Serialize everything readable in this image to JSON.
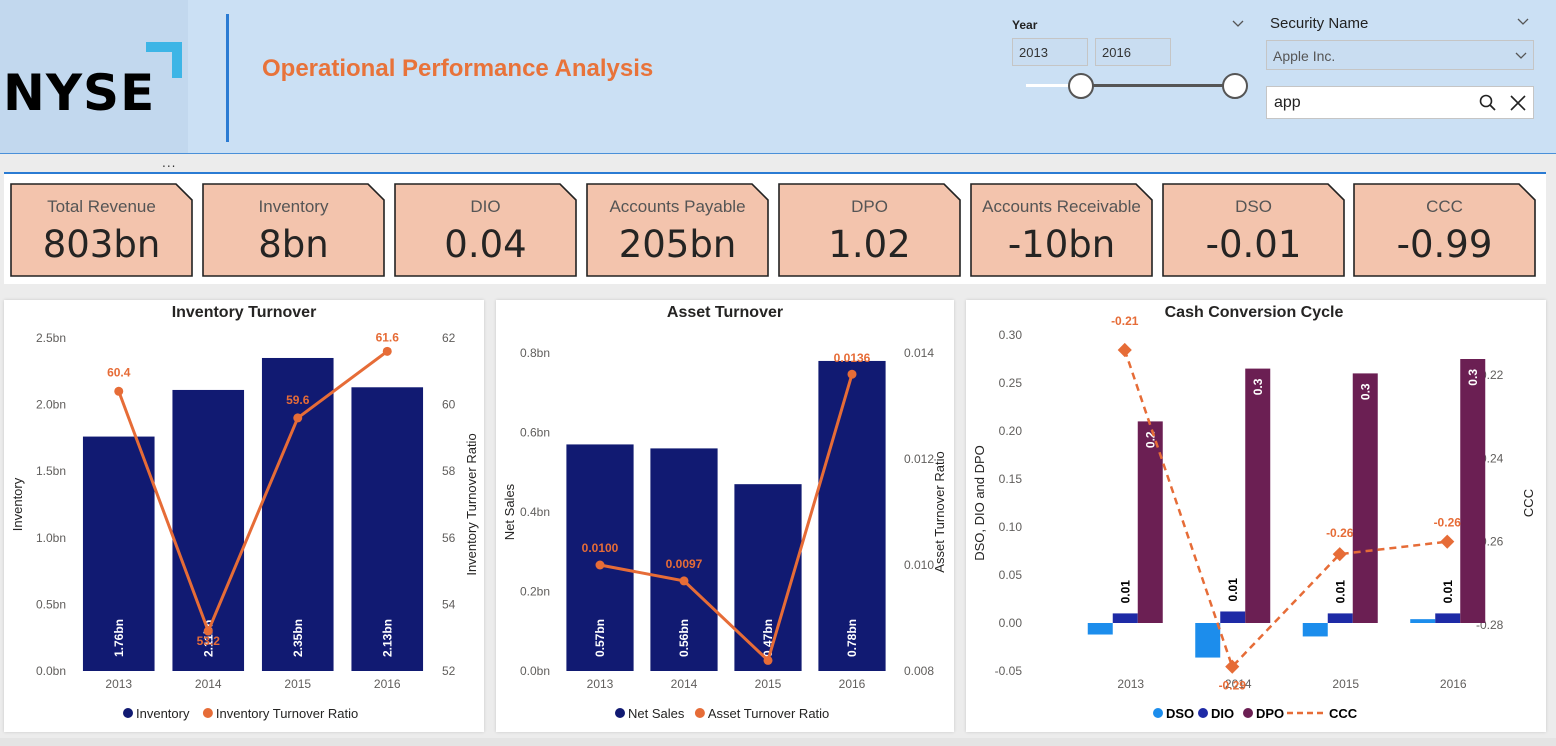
{
  "header": {
    "logo_text": "NYSE",
    "title": "Operational Performance Analysis",
    "more_dots": "..."
  },
  "year_slicer": {
    "label": "Year",
    "start": "2013",
    "end": "2016",
    "range_fraction": [
      0.25,
      1.0
    ]
  },
  "security_slicer": {
    "label": "Security Name",
    "selected": "Apple Inc.",
    "search_value": "app",
    "icons": [
      "search-icon",
      "clear-icon"
    ]
  },
  "kpis": [
    {
      "label": "Total Revenue",
      "value": "803bn"
    },
    {
      "label": "Inventory",
      "value": "8bn"
    },
    {
      "label": "DIO",
      "value": "0.04"
    },
    {
      "label": "Accounts Payable",
      "value": "205bn"
    },
    {
      "label": "DPO",
      "value": "1.02"
    },
    {
      "label": "Accounts Receivable",
      "value": "-10bn"
    },
    {
      "label": "DSO",
      "value": "-0.01"
    },
    {
      "label": "CCC",
      "value": "-0.99"
    }
  ],
  "colors": {
    "bar_navy": "#111a72",
    "line_orange": "#e66c37",
    "dso_blue": "#1c8dec",
    "dio_blue": "#1e2aa6",
    "dpo_purple": "#6b1f53",
    "kpi_fill": "#f3c4ad",
    "title_orange": "#e8733a"
  },
  "chart_data": [
    {
      "type": "bar",
      "title": "Inventory Turnover",
      "categories": [
        "2013",
        "2014",
        "2015",
        "2016"
      ],
      "ylabel": "Inventory",
      "y2label": "Inventory Turnover Ratio",
      "ylim": [
        0,
        2.5
      ],
      "yticks": [
        "0.0bn",
        "0.5bn",
        "1.0bn",
        "1.5bn",
        "2.0bn",
        "2.5bn"
      ],
      "y2lim": [
        52,
        62
      ],
      "y2ticks": [
        "52",
        "54",
        "56",
        "58",
        "60",
        "62"
      ],
      "series": [
        {
          "name": "Inventory",
          "kind": "bar",
          "values": [
            1.76,
            2.11,
            2.35,
            2.13
          ],
          "labels": [
            "1.76bn",
            "2.11bn",
            "2.35bn",
            "2.13bn"
          ]
        },
        {
          "name": "Inventory Turnover Ratio",
          "kind": "line",
          "values": [
            60.4,
            53.2,
            59.6,
            61.6
          ],
          "labels": [
            "60.4",
            "53.2",
            "59.6",
            "61.6"
          ]
        }
      ],
      "legend_position": "bottom"
    },
    {
      "type": "bar",
      "title": "Asset Turnover",
      "categories": [
        "2013",
        "2014",
        "2015",
        "2016"
      ],
      "ylabel": "Net Sales",
      "y2label": "Asset Turnover Ratio",
      "ylim": [
        0,
        0.8
      ],
      "yticks": [
        "0.0bn",
        "0.2bn",
        "0.4bn",
        "0.6bn",
        "0.8bn"
      ],
      "y2lim": [
        0.008,
        0.014
      ],
      "y2ticks": [
        "0.008",
        "0.010",
        "0.012",
        "0.014"
      ],
      "series": [
        {
          "name": "Net Sales",
          "kind": "bar",
          "values": [
            0.57,
            0.56,
            0.47,
            0.78
          ],
          "labels": [
            "0.57bn",
            "0.56bn",
            "0.47bn",
            "0.78bn"
          ]
        },
        {
          "name": "Asset Turnover Ratio",
          "kind": "line",
          "values": [
            0.01,
            0.0097,
            0.0082,
            0.0136
          ],
          "labels": [
            "0.0100",
            "0.0097",
            "",
            "0.0136"
          ]
        }
      ],
      "legend_position": "bottom"
    },
    {
      "type": "bar",
      "title": "Cash Conversion Cycle",
      "categories": [
        "2013",
        "2014",
        "2015",
        "2016"
      ],
      "ylabel": "DSO, DIO and DPO",
      "y2label": "CCC",
      "ylim": [
        -0.05,
        0.3
      ],
      "yticks": [
        "-0.05",
        "0.00",
        "0.05",
        "0.10",
        "0.15",
        "0.20",
        "0.25",
        "0.30"
      ],
      "y2lim": [
        -0.28,
        -0.22
      ],
      "y2ticks": [
        "-0.28",
        "-0.26",
        "-0.24",
        "-0.22"
      ],
      "series": [
        {
          "name": "DSO",
          "kind": "bar",
          "values": [
            -0.012,
            -0.036,
            -0.014,
            0.004
          ]
        },
        {
          "name": "DIO",
          "kind": "bar",
          "values": [
            0.01,
            0.012,
            0.01,
            0.01
          ],
          "labels": [
            "0.01",
            "0.01",
            "0.01",
            "0.01"
          ]
        },
        {
          "name": "DPO",
          "kind": "bar",
          "values": [
            0.21,
            0.265,
            0.26,
            0.275
          ],
          "labels": [
            "0.2",
            "0.3",
            "0.3",
            "0.3"
          ]
        },
        {
          "name": "CCC",
          "kind": "line",
          "dashed": true,
          "values": [
            -0.214,
            -0.29,
            -0.263,
            -0.26
          ],
          "labels": [
            "-0.21",
            "-0.29",
            "-0.26",
            "-0.26"
          ]
        }
      ],
      "legend_position": "bottom"
    }
  ]
}
